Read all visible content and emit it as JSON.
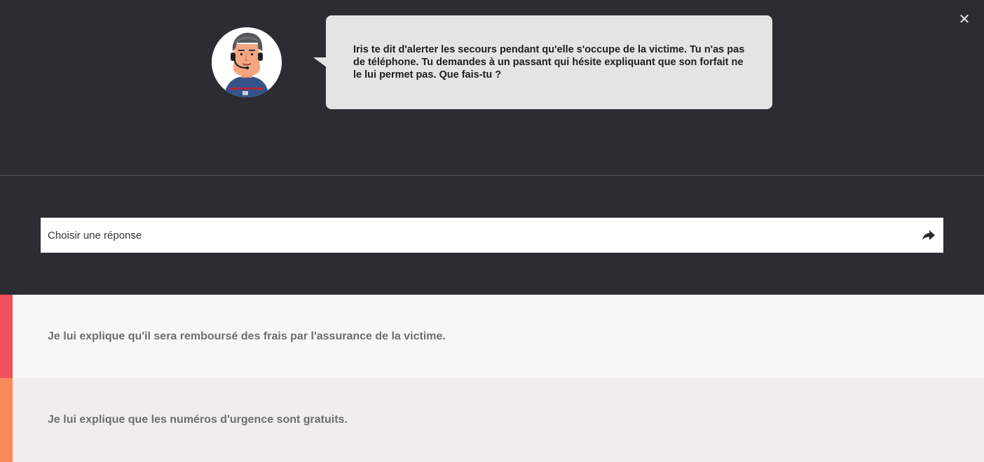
{
  "dialog": {
    "close_label": "✕",
    "message": "Iris te dit d'alerter les secours pendant qu'elle s'occupe de la victime. Tu n'as pas de téléphone. Tu demandes à un passant qui hésite expliquant que son forfait ne le lui permet pas. Que fais-tu ?"
  },
  "answer_bar": {
    "placeholder": "Choisir une réponse",
    "send_icon": "share-arrow-icon"
  },
  "options": [
    {
      "label": "Je lui explique qu'il sera remboursé des frais par l'assurance de la victime.",
      "accent_color": "#f2505a"
    },
    {
      "label": "Je lui explique que les numéros d'urgence sont gratuits.",
      "accent_color": "#fb8a5b"
    }
  ],
  "colors": {
    "background": "#2c2d32",
    "bubble": "#e4e4e4"
  }
}
